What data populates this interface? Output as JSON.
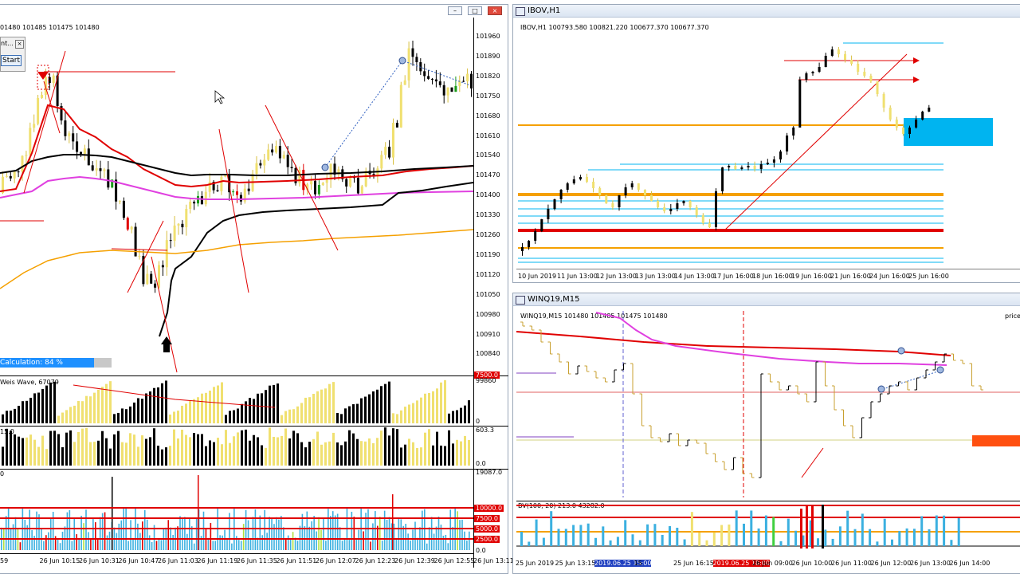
{
  "left_chart": {
    "ohlc": "01480 101485 101475 101480",
    "prices": [
      "101960",
      "101890",
      "101820",
      "101750",
      "101680",
      "101610",
      "101540",
      "101470",
      "101400",
      "101330",
      "101260",
      "101190",
      "101120",
      "101050",
      "100980",
      "100910",
      "100840"
    ],
    "time_labels": [
      "59",
      "26 Jun 10:15",
      "26 Jun 10:31",
      "26 Jun 10:47",
      "26 Jun 11:03",
      "26 Jun 11:19",
      "26 Jun 11:35",
      "26 Jun 11:51",
      "26 Jun 12:07",
      "26 Jun 12:23",
      "26 Jun 12:39",
      "26 Jun 12:55",
      "26 Jun 13:11"
    ],
    "dialog": {
      "title": "nt...",
      "close": "×",
      "start": "Start"
    },
    "calculation": {
      "label": "Calculation:  84 %",
      "progress": 0.84
    },
    "weis_wave": {
      "label": "Weis Wave, 67079",
      "tag": "7500.0",
      "max": "99860",
      "min": "0"
    },
    "sub2": {
      "label": "15.0",
      "max": "603.3",
      "min": "0.0"
    },
    "sub3": {
      "label": "0",
      "max": "19087.0",
      "levels": [
        "10000.0",
        "7500.0",
        "5000.0",
        "2500.0"
      ],
      "min": "0.0"
    }
  },
  "ibov": {
    "title": "IBOV,H1",
    "ohlc": "IBOV,H1  100793.580 100821.220 100677.370 100677.370",
    "time_labels": [
      "10 Jun 2019",
      "11 Jun 13:00",
      "12 Jun 13:00",
      "13 Jun 13:00",
      "14 Jun 13:00",
      "17 Jun 16:00",
      "18 Jun 16:00",
      "19 Jun 16:00",
      "21 Jun 16:00",
      "24 Jun 16:00",
      "25 Jun 16:00"
    ]
  },
  "winq": {
    "title": "WINQ19,M15",
    "ohlc": "WINQ19,M15  101480 101485 101475 101480",
    "right_text": "priceh",
    "bv_label": "BV(100, 20) 213.0 43282.0",
    "time_labels": [
      "25 Jun 2019",
      "25 Jun 13:15",
      "2019.06.25 15:00",
      "15",
      "25 Jun 16:15",
      "2019.06.25 18:00",
      "26 Jun 09:00",
      "26 Jun 10:00",
      "26 Jun 11:00",
      "26 Jun 12:00",
      "26 Jun 13:00",
      "26 Jun 14:00"
    ]
  },
  "colors": {
    "bull": "#1a9b1a",
    "bear": "#e60000",
    "gold": "#f0e070",
    "black": "#000000",
    "magenta": "#e040e0",
    "orange": "#f5a000",
    "cyan": "#00b4f0",
    "red": "#e00000"
  },
  "icons": [
    "minimize-icon",
    "restore-icon",
    "close-icon",
    "chart-window-icon",
    "arrow-down-icon",
    "arrow-up-icon",
    "cursor-icon"
  ]
}
